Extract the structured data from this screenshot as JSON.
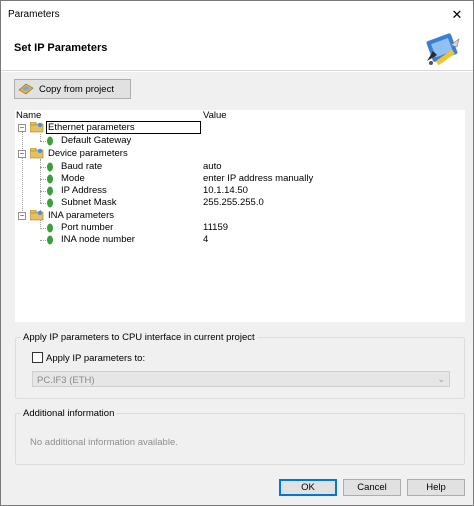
{
  "window": {
    "title": "Parameters",
    "close_glyph": "✕"
  },
  "header": {
    "title": "Set IP Parameters",
    "icon": "network-tools-icon"
  },
  "toolbar": {
    "copy_label": "Copy from project",
    "copy_icon": "copy-project-icon"
  },
  "tree": {
    "columns": {
      "name": "Name",
      "value": "Value"
    },
    "rows": [
      {
        "name": "Ethernet parameters",
        "value": "",
        "kind": "folder",
        "selected": true
      },
      {
        "name": "Default Gateway",
        "value": "",
        "kind": "leaf"
      },
      {
        "name": "Device parameters",
        "value": "",
        "kind": "folder"
      },
      {
        "name": "Baud rate",
        "value": "auto",
        "kind": "leaf"
      },
      {
        "name": "Mode",
        "value": "enter IP address manually",
        "kind": "leaf"
      },
      {
        "name": "IP Address",
        "value": "10.1.14.50",
        "kind": "leaf"
      },
      {
        "name": "Subnet Mask",
        "value": "255.255.255.0",
        "kind": "leaf"
      },
      {
        "name": "INA parameters",
        "value": "",
        "kind": "folder"
      },
      {
        "name": "Port number",
        "value": "11159",
        "kind": "leaf"
      },
      {
        "name": "INA node number",
        "value": "4",
        "kind": "leaf"
      }
    ],
    "expander_glyph": "−"
  },
  "apply_group": {
    "title": "Apply IP parameters to CPU interface in current project",
    "checkbox_label": "Apply IP parameters to:",
    "checked": false,
    "dropdown_value": "PC.IF3 (ETH)",
    "dropdown_arrow": "⌄"
  },
  "info_group": {
    "title": "Additional information",
    "text": "No additional information available."
  },
  "buttons": {
    "ok": "OK",
    "cancel": "Cancel",
    "help": "Help"
  },
  "colors": {
    "accent": "#0078d7",
    "leaf_icon": "#3aa13a",
    "folder": "#e8c060"
  }
}
